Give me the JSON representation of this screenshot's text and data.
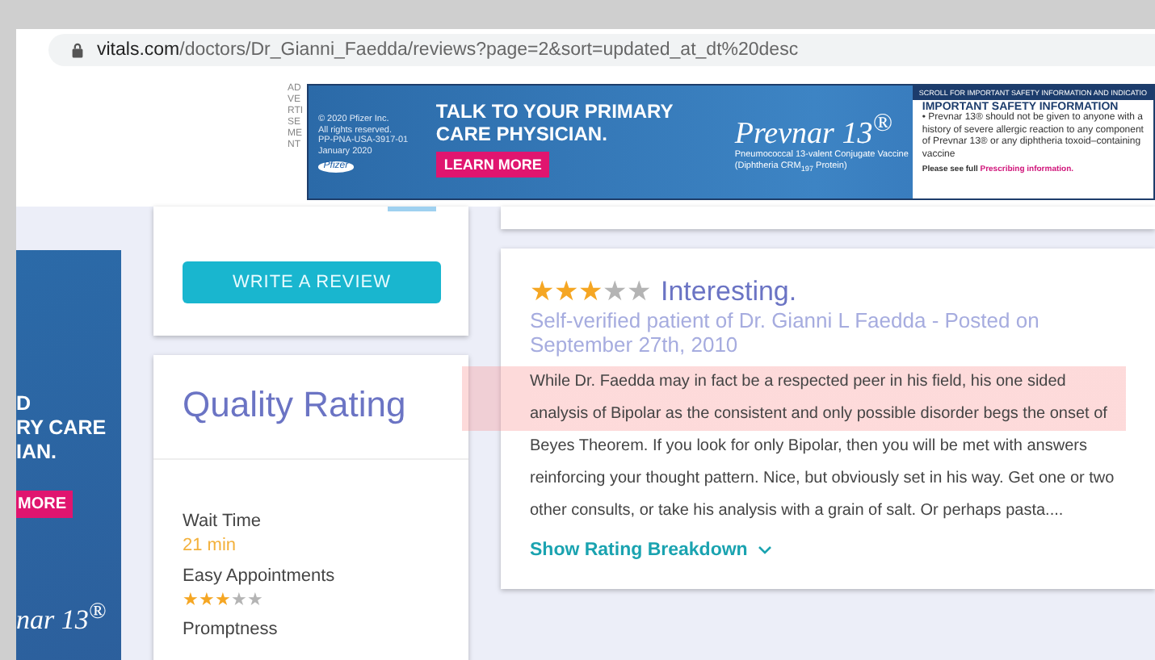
{
  "browser": {
    "url_domain": "vitals.com",
    "url_path": "/doctors/Dr_Gianni_Faedda/reviews?page=2&sort=updated_at_dt%20desc"
  },
  "top_ad": {
    "side_label": "ADVERTISEMENT",
    "legal": [
      "© 2020 Pfizer Inc.",
      "All rights reserved.",
      "PP-PNA-USA-3917-01",
      "January 2020"
    ],
    "logo": "Pfizer",
    "headline": "TALK TO YOUR PRIMARY CARE PHYSICIAN.",
    "button": "LEARN MORE",
    "brand": "Prevnar 13$^{®}$",
    "brand_sub": "Pneumococcal 13-valent Conjugate Vaccine (Diphtheria CRM$_{197}$ Protein)",
    "safety_header": "SCROLL FOR IMPORTANT SAFETY INFORMATION AND INDICATIO",
    "safety_title": "IMPORTANT SAFETY INFORMATION",
    "safety_text": "• Prevnar 13® should not be given to anyone with a history of severe allergic reaction to any component of Prevnar 13® or any diphtheria toxoid–containing vaccine",
    "safety_note": "Please see full",
    "safety_link": "Prescribing information."
  },
  "left_ad": {
    "headline_lines": [
      "D",
      "RY CARE",
      "IAN."
    ],
    "button": "MORE",
    "brand": "nar 13$^{®}$"
  },
  "sidebar": {
    "write_review_button": "WRITE A REVIEW",
    "quality_rating": {
      "title": "Quality Rating",
      "items": [
        {
          "kind": "text",
          "label": "Wait Time",
          "value": "21 min"
        },
        {
          "kind": "stars",
          "label": "Easy Appointments",
          "stars": 3
        },
        {
          "kind": "label",
          "label": "Promptness"
        }
      ]
    }
  },
  "review": {
    "stars": 3,
    "title": "Interesting.",
    "meta": "Self-verified patient of Dr. Gianni L Faedda - Posted on September 27th, 2010",
    "body": "While Dr. Faedda may in fact be a respected peer in his field, his one sided analysis of Bipolar as the consistent and only possible disorder begs the onset of Beyes Theorem. If you look for only Bipolar, then you will be met with answers reinforcing your thought pattern. Nice, but obviously set in his way. Get one or two other consults, or take his analysis with a grain of salt. Or perhaps pasta....",
    "toggle": "Show Rating Breakdown"
  }
}
